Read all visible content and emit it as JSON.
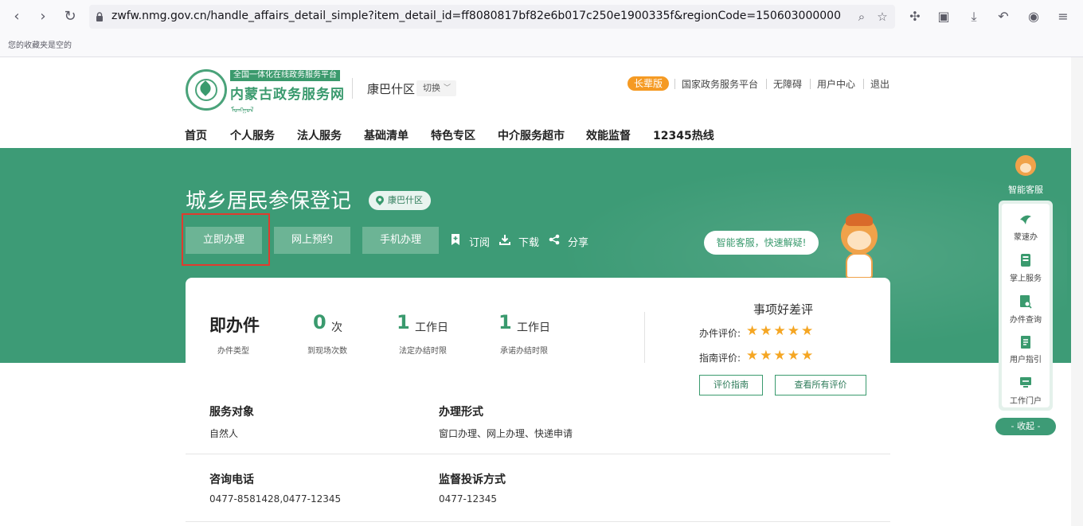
{
  "browser": {
    "url": "zwfw.nmg.gov.cn/handle_affairs_detail_simple?item_detail_id=ff8080817bf82e6b017c250e1900335f&regionCode=150603000000",
    "bookmark_empty": "您的收藏夹是空的"
  },
  "header": {
    "logo_tag": "全国一体化在线政务服务平台",
    "logo_title": "内蒙古政务服务网",
    "logo_mongol": "ᠮᠣᠩᠭᠣᠯ ᠰᠢᠶᠠᠳ",
    "region": "康巴什区",
    "switch_label": "切换",
    "elder_mode": "长辈版",
    "top_links": [
      "国家政务服务平台",
      "无障碍",
      "用户中心",
      "退出"
    ],
    "nav": [
      "首页",
      "个人服务",
      "法人服务",
      "基础清单",
      "特色专区",
      "中介服务超市",
      "效能监督",
      "12345热线"
    ]
  },
  "item": {
    "title": "城乡居民参保登记",
    "region_tag": "康巴什区",
    "actions": [
      "立即办理",
      "网上预约",
      "手机办理"
    ],
    "tools": [
      "订阅",
      "下载",
      "分享"
    ],
    "bubble": "智能客服，快速解疑!"
  },
  "stats": {
    "type_value": "即办件",
    "type_label": "办件类型",
    "visits_value": "0",
    "visits_unit": "次",
    "visits_label": "到现场次数",
    "legal_value": "1",
    "legal_unit": "工作日",
    "legal_label": "法定办结时限",
    "promise_value": "1",
    "promise_unit": "工作日",
    "promise_label": "承诺办结时限"
  },
  "rating": {
    "title": "事项好差评",
    "item_label": "办件评价:",
    "guide_label": "指南评价:",
    "item_stars": 5,
    "guide_stars": 5,
    "btn_guide": "评价指南",
    "btn_all": "查看所有评价"
  },
  "fields": {
    "target_title": "服务对象",
    "target_value": "自然人",
    "form_title": "办理形式",
    "form_value": "窗口办理、网上办理、快递申请",
    "phone_title": "咨询电话",
    "phone_value": "0477-8581428,0477-12345",
    "complaint_title": "监督投诉方式",
    "complaint_value": "0477-12345"
  },
  "side": {
    "ai_label": "智能客服",
    "items": [
      "蒙速办",
      "掌上服务",
      "办件查询",
      "用户指引",
      "工作门户"
    ],
    "collapse": "- 收起 -"
  },
  "colors": {
    "brand_green": "#3d9b76",
    "accent_orange": "#f59a23",
    "star": "#f5a623",
    "highlight_red": "#e03b2e"
  }
}
